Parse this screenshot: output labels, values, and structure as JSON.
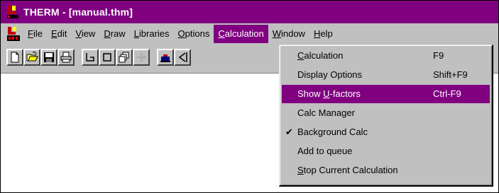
{
  "window": {
    "title": "THERM - [manual.thm]"
  },
  "menubar": {
    "items": [
      {
        "label": "File",
        "mn": "F",
        "rest": "ile"
      },
      {
        "label": "Edit",
        "mn": "E",
        "rest": "dit"
      },
      {
        "label": "View",
        "mn": "V",
        "rest": "iew"
      },
      {
        "label": "Draw",
        "mn": "D",
        "rest": "raw"
      },
      {
        "label": "Libraries",
        "mn": "L",
        "rest": "ibraries"
      },
      {
        "label": "Options",
        "mn": "O",
        "rest": "ptions"
      },
      {
        "label": "Calculation",
        "mn": "C",
        "rest": "alculation"
      },
      {
        "label": "Window",
        "mn": "W",
        "rest": "indow"
      },
      {
        "label": "Help",
        "mn": "H",
        "rest": "elp"
      }
    ],
    "active": "Calculation"
  },
  "toolbar": {
    "buttons": [
      "new-file-icon",
      "open-folder-icon",
      "save-icon",
      "print-icon",
      "polygon-icon",
      "rectangle-icon",
      "fill-void-icon",
      "locate-point-icon",
      "boundary-condition-icon",
      "draw-line-icon"
    ]
  },
  "calculation_menu": {
    "items": [
      {
        "pre": "",
        "mn": "C",
        "post": "alculation",
        "shortcut": "F9",
        "checked": false,
        "highlighted": false
      },
      {
        "pre": "Display Options",
        "mn": "",
        "post": "",
        "shortcut": "Shift+F9",
        "checked": false,
        "highlighted": false
      },
      {
        "pre": "Show ",
        "mn": "U",
        "post": "-factors",
        "shortcut": "Ctrl-F9",
        "checked": false,
        "highlighted": true
      },
      {
        "pre": "Calc Manager",
        "mn": "",
        "post": "",
        "shortcut": "",
        "checked": false,
        "highlighted": false
      },
      {
        "pre": "Background Calc",
        "mn": "",
        "post": "",
        "shortcut": "",
        "checked": true,
        "highlighted": false
      },
      {
        "pre": "Add to queue",
        "mn": "",
        "post": "",
        "shortcut": "",
        "checked": false,
        "highlighted": false
      },
      {
        "pre": "",
        "mn": "S",
        "post": "top Current Calculation",
        "shortcut": "",
        "checked": false,
        "highlighted": false
      }
    ],
    "check_glyph": "✔"
  },
  "colors": {
    "accent": "#800080",
    "face": "#c0c0c0"
  }
}
